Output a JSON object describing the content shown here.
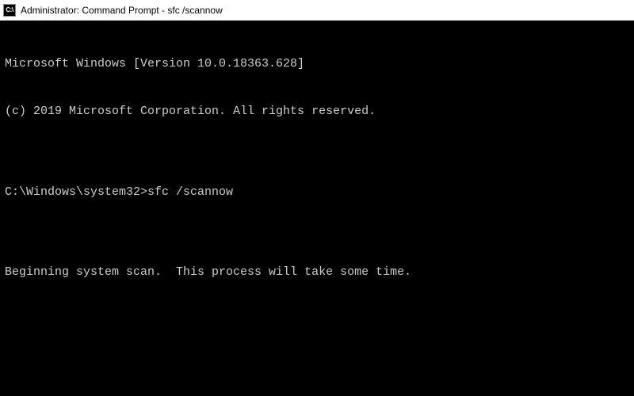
{
  "titlebar": {
    "icon_label": "C:\\",
    "title": "Administrator: Command Prompt - sfc  /scannow"
  },
  "terminal": {
    "line1": "Microsoft Windows [Version 10.0.18363.628]",
    "line2": "(c) 2019 Microsoft Corporation. All rights reserved.",
    "blank1": "",
    "prompt": "C:\\Windows\\system32>",
    "command": "sfc /scannow",
    "blank2": "",
    "line3": "Beginning system scan.  This process will take some time."
  }
}
